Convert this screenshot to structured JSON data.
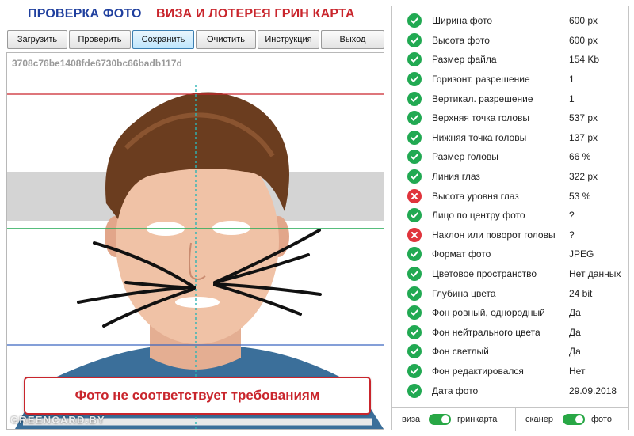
{
  "header": {
    "title_left": "ПРОВЕРКА ФОТО",
    "title_right": "ВИЗА И ЛОТЕРЕЯ ГРИН КАРТА"
  },
  "toolbar": {
    "buttons": [
      "Загрузить",
      "Проверить",
      "Сохранить",
      "Очистить",
      "Инструкция",
      "Выход"
    ],
    "active_index": 2
  },
  "photo": {
    "hash": "3708c76be1408fde6730bc66badb117d",
    "verdict": "Фото не соответствует требованиям",
    "watermark": "GREENCARD.BY"
  },
  "checks": [
    {
      "label": "Ширина фото",
      "value": "600 px",
      "status": "ok"
    },
    {
      "label": "Высота фото",
      "value": "600 px",
      "status": "ok"
    },
    {
      "label": "Размер файла",
      "value": "154 Kb",
      "status": "ok"
    },
    {
      "label": "Горизонт. разрешение",
      "value": "1",
      "status": "ok"
    },
    {
      "label": "Вертикал. разрешение",
      "value": "1",
      "status": "ok"
    },
    {
      "label": "Верхняя точка головы",
      "value": "537 px",
      "status": "ok"
    },
    {
      "label": "Нижняя точка головы",
      "value": "137 px",
      "status": "ok"
    },
    {
      "label": "Размер головы",
      "value": "66 %",
      "status": "ok"
    },
    {
      "label": "Линия глаз",
      "value": "322 px",
      "status": "ok"
    },
    {
      "label": "Высота уровня глаз",
      "value": "53 %",
      "status": "bad"
    },
    {
      "label": "Лицо по центру фото",
      "value": "?",
      "status": "ok"
    },
    {
      "label": "Наклон или поворот головы",
      "value": "?",
      "status": "bad"
    },
    {
      "label": "Формат фото",
      "value": "JPEG",
      "status": "ok"
    },
    {
      "label": "Цветовое пространство",
      "value": "Нет данных",
      "status": "ok"
    },
    {
      "label": "Глубина цвета",
      "value": "24 bit",
      "status": "ok"
    },
    {
      "label": "Фон ровный, однородный",
      "value": "Да",
      "status": "ok"
    },
    {
      "label": "Фон нейтрального цвета",
      "value": "Да",
      "status": "ok"
    },
    {
      "label": "Фон светлый",
      "value": "Да",
      "status": "ok"
    },
    {
      "label": "Фон редактировался",
      "value": "Нет",
      "status": "ok"
    },
    {
      "label": "Дата фото",
      "value": "29.09.2018",
      "status": "ok"
    }
  ],
  "footer": {
    "mode_left": "виза",
    "mode_right": "гринкарта",
    "mode_on": true,
    "source_left": "сканер",
    "source_right": "фото",
    "source_on": true
  },
  "colors": {
    "ok": "#21a952",
    "bad": "#e0343c",
    "title_blue": "#1f3f9e",
    "title_red": "#c9252c",
    "toggle_on": "#28a745"
  },
  "icons": {
    "ok": "check-circle-icon",
    "bad": "x-circle-icon"
  }
}
